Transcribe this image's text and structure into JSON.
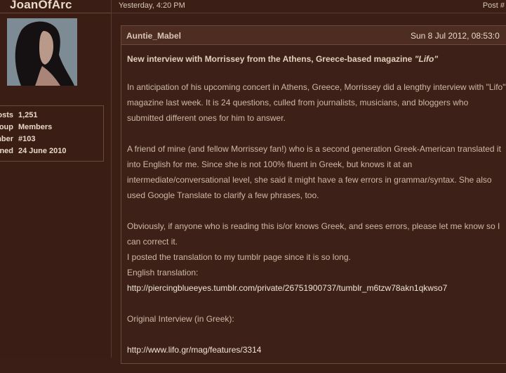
{
  "profile": {
    "username": "JoanOfArc",
    "stats": [
      {
        "label": "Posts:",
        "value": "1,251"
      },
      {
        "label": "Group:",
        "value": "Members"
      },
      {
        "label": "Member",
        "value": "#103"
      },
      {
        "label": "Joined:",
        "value": "24 June 2010"
      }
    ]
  },
  "meta": {
    "timestamp": "Yesterday, 4:20 PM",
    "post_link": "Post #"
  },
  "quote": {
    "author": "Auntie_Mabel",
    "date": "Sun 8 Jul 2012, 08:53:0",
    "headline_text": "New interview with Morrissey from the Athens, Greece-based magazine",
    "headline_em": "\"Lifo\"",
    "para1": "In anticipation of his upcoming concert in Athens, Greece, Morrissey did a lengthy interview with \"Lifo\" magazine last week. It is 24 questions, culled from journalists, musicians, and bloggers who submitted different ones for him to answer.",
    "para2": "A friend of mine (and fellow Morrissey fan!) who is a second generation Greek-American translated it into English for me. Since she is not 100% fluent in Greek, but knows it at an intermediate/conversational level, she said it might have a few errors in grammar/syntax. She also used Google Translate to clarify a few phrases, too.",
    "para3_line1": "Obviously, if anyone who is reading this is/or knows Greek, and sees errors, please let me know so I can correct it.",
    "para3_line2": "I posted the translation to my tumblr page since it is so long.",
    "para3_line3": "English translation:",
    "english_link": "http://piercingblueeyes.tumblr.com/private/26751900737/tumblr_m6tzw78akn1qkwso7",
    "original_label": "Original Interview (in Greek):",
    "original_link": "http://www.lifo.gr/mag/features/3314"
  },
  "colors": {
    "background": "#3b1f16",
    "text": "#cdb8a4",
    "border": "#6b4a3c"
  }
}
